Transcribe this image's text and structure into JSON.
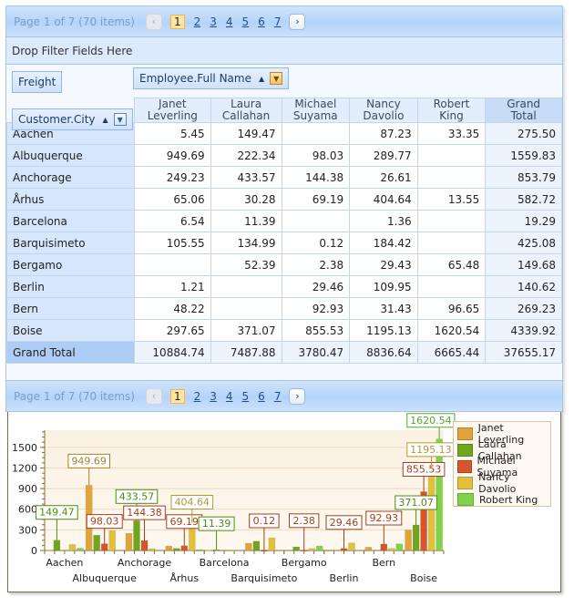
{
  "pager": {
    "summary": "Page 1 of 7 (70 items)",
    "prev_icon": "‹",
    "next_icon": "›",
    "pages": [
      "1",
      "2",
      "3",
      "4",
      "5",
      "6",
      "7"
    ],
    "active_page": "1"
  },
  "filter_area": {
    "label": "Drop Filter Fields Here"
  },
  "fields": {
    "data_field": "Freight",
    "column_field": "Employee.Full Name",
    "row_field": "Customer.City",
    "sort_icon": "▲",
    "filter_icon": "▼"
  },
  "columns": [
    {
      "line1": "Janet",
      "line2": "Leverling"
    },
    {
      "line1": "Laura",
      "line2": "Callahan"
    },
    {
      "line1": "Michael",
      "line2": "Suyama"
    },
    {
      "line1": "Nancy",
      "line2": "Davolio"
    },
    {
      "line1": "Robert",
      "line2": "King"
    },
    {
      "line1": "Grand",
      "line2": "Total"
    }
  ],
  "rows": [
    {
      "city": "Aachen",
      "values": [
        "5.45",
        "149.47",
        "",
        "87.23",
        "33.35",
        "275.50"
      ]
    },
    {
      "city": "Albuquerque",
      "values": [
        "949.69",
        "222.34",
        "98.03",
        "289.77",
        "",
        "1559.83"
      ]
    },
    {
      "city": "Anchorage",
      "values": [
        "249.23",
        "433.57",
        "144.38",
        "26.61",
        "",
        "853.79"
      ]
    },
    {
      "city": "Århus",
      "values": [
        "65.06",
        "30.28",
        "69.19",
        "404.64",
        "13.55",
        "582.72"
      ]
    },
    {
      "city": "Barcelona",
      "values": [
        "6.54",
        "11.39",
        "",
        "1.36",
        "",
        "19.29"
      ]
    },
    {
      "city": "Barquisimeto",
      "values": [
        "105.55",
        "134.99",
        "0.12",
        "184.42",
        "",
        "425.08"
      ]
    },
    {
      "city": "Bergamo",
      "values": [
        "",
        "52.39",
        "2.38",
        "29.43",
        "65.48",
        "149.68"
      ]
    },
    {
      "city": "Berlin",
      "values": [
        "1.21",
        "",
        "29.46",
        "109.95",
        "",
        "140.62"
      ]
    },
    {
      "city": "Bern",
      "values": [
        "48.22",
        "",
        "92.93",
        "31.43",
        "96.65",
        "269.23"
      ]
    },
    {
      "city": "Boise",
      "values": [
        "297.65",
        "371.07",
        "855.53",
        "1195.13",
        "1620.54",
        "4339.92"
      ]
    }
  ],
  "grand_total": {
    "label": "Grand Total",
    "values": [
      "10884.74",
      "7487.88",
      "3780.47",
      "8836.64",
      "6665.44",
      "37655.17"
    ]
  },
  "chart_data": {
    "type": "bar",
    "title": "",
    "xlabel": "",
    "ylabel": "",
    "ylim": [
      0,
      1750
    ],
    "yticks": [
      0,
      300,
      600,
      900,
      1200,
      1500
    ],
    "grid": true,
    "legend_position": "top-right",
    "categories": [
      "Aachen",
      "Albuquerque",
      "Anchorage",
      "Århus",
      "Barcelona",
      "Barquisimeto",
      "Bergamo",
      "Berlin",
      "Bern",
      "Boise"
    ],
    "series": [
      {
        "name": "Janet Leverling",
        "color": "#e0a43a",
        "values": [
          5.45,
          949.69,
          249.23,
          65.06,
          6.54,
          105.55,
          0,
          1.21,
          48.22,
          297.65
        ]
      },
      {
        "name": "Laura Callahan",
        "color": "#6fa61e",
        "values": [
          149.47,
          222.34,
          433.57,
          30.28,
          11.39,
          134.99,
          52.39,
          0,
          0,
          371.07
        ]
      },
      {
        "name": "Michael Suyama",
        "color": "#d9542a",
        "values": [
          0,
          98.03,
          144.38,
          69.19,
          0,
          0.12,
          2.38,
          29.46,
          92.93,
          855.53
        ]
      },
      {
        "name": "Nancy Davolio",
        "color": "#e2c03c",
        "values": [
          87.23,
          289.77,
          26.61,
          404.64,
          1.36,
          184.42,
          29.43,
          109.95,
          31.43,
          1195.13
        ]
      },
      {
        "name": "Robert King",
        "color": "#7ed448",
        "values": [
          33.35,
          0,
          0,
          13.55,
          0,
          0,
          65.48,
          0,
          96.65,
          1620.54
        ]
      }
    ],
    "annotations": [
      {
        "category": "Aachen",
        "series": "Laura Callahan",
        "label": "149.47"
      },
      {
        "category": "Albuquerque",
        "series": "Janet Leverling",
        "label": "949.69"
      },
      {
        "category": "Albuquerque",
        "series": "Michael Suyama",
        "label": "98.03"
      },
      {
        "category": "Anchorage",
        "series": "Laura Callahan",
        "label": "433.57"
      },
      {
        "category": "Anchorage",
        "series": "Michael Suyama",
        "label": "144.38"
      },
      {
        "category": "Århus",
        "series": "Michael Suyama",
        "label": "69.19"
      },
      {
        "category": "Århus",
        "series": "Nancy Davolio",
        "label": "404.64"
      },
      {
        "category": "Barcelona",
        "series": "Laura Callahan",
        "label": "11.39"
      },
      {
        "category": "Barquisimeto",
        "series": "Michael Suyama",
        "label": "0.12"
      },
      {
        "category": "Bergamo",
        "series": "Michael Suyama",
        "label": "2.38"
      },
      {
        "category": "Berlin",
        "series": "Michael Suyama",
        "label": "29.46"
      },
      {
        "category": "Bern",
        "series": "Michael Suyama",
        "label": "92.93"
      },
      {
        "category": "Boise",
        "series": "Laura Callahan",
        "label": "371.07"
      },
      {
        "category": "Boise",
        "series": "Michael Suyama",
        "label": "855.53"
      },
      {
        "category": "Boise",
        "series": "Nancy Davolio",
        "label": "1195.13"
      },
      {
        "category": "Boise",
        "series": "Robert King",
        "label": "1620.54"
      }
    ]
  }
}
